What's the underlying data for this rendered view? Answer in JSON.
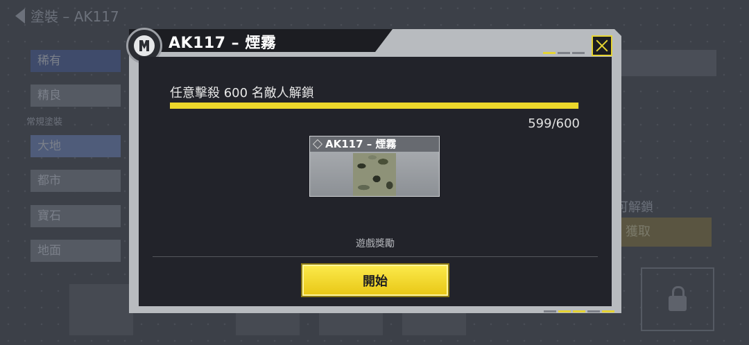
{
  "background": {
    "title": "塗裝 – AK117",
    "tabs": [
      "稀有",
      "精良",
      "大地",
      "都市",
      "寶石",
      "地面"
    ],
    "section_label": "常規塗裝",
    "unlock_text": "可解鎖",
    "get_button": "獲取"
  },
  "dialog": {
    "title": "AK117 – 煙霧",
    "task_text": "任意擊殺 600 名敵人解鎖",
    "progress": {
      "current": 599,
      "total": 600,
      "text": "599/600"
    },
    "reward_item": {
      "name": "AK117 – 煙霧"
    },
    "rewards_label": "遊戲獎勵",
    "start_button": "開始",
    "accent_color": "#ecd72b",
    "icons": {
      "close": "close-icon",
      "badge": "mode-badge-icon",
      "reward": "diamond-icon"
    }
  }
}
